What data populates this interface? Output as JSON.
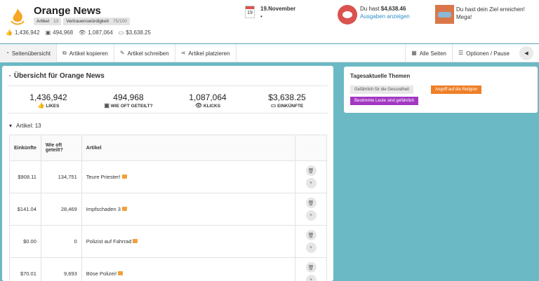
{
  "header": {
    "brand": "Orange News",
    "badges": {
      "article_label": "Artikel",
      "article_count": "13",
      "trust_label": "Vertrauenswürdigkeit",
      "trust_value": "75/100"
    },
    "stats": {
      "likes": "1,436,942",
      "shares": "494,968",
      "clicks": "1,087,064",
      "income": "$3,638.25"
    },
    "date": "19.November",
    "calendar_day": "19",
    "dot": "•",
    "money_prefix": "Du hast ",
    "money_value": "$4,638.46",
    "money_link": "Ausgaben anzeigen",
    "goal_text": "Du hast dein Ziel erreichen! Mega!"
  },
  "nav": {
    "overview": "Seitenübersicht",
    "copy": "Artikel kopieren",
    "write": "Artikel schreiben",
    "place": "Artikel platzieren",
    "all_pages": "Alle Seiten",
    "options": "Optionen / Pause"
  },
  "main": {
    "title": "Übersicht für Orange News",
    "kpis": {
      "likes_value": "1,436,942",
      "likes_label": "LIKES",
      "shares_value": "494,968",
      "shares_label": "WIE OFT GETEILT?",
      "clicks_value": "1,087,064",
      "clicks_label": "KLICKS",
      "income_value": "$3,638.25",
      "income_label": "EINKÜNFTE"
    },
    "articles_label": "Artikel: 13",
    "table": {
      "headers": {
        "income": "Einkünfte",
        "shares": "Wie oft geteilt?",
        "article": "Artikel"
      },
      "rows": [
        {
          "income": "$908.11",
          "shares": "134,751",
          "title": "Teure Priester!"
        },
        {
          "income": "$141.04",
          "shares": "28,469",
          "title": "Impfschaden 3"
        },
        {
          "income": "$0.00",
          "shares": "0",
          "title": "Polizist auf Fahrrad"
        },
        {
          "income": "$70.01",
          "shares": "9,693",
          "title": "Böse Polizei!"
        }
      ]
    }
  },
  "side": {
    "title": "Tagesaktuelle Themen",
    "tags": [
      "Gefährlich für die Gesundheit",
      "Angriff auf die Religion",
      "Bestimmte Leute sind gefährlich"
    ]
  },
  "colors": {
    "accent": "#6bb9c4",
    "orange_tag": "#ef7f27",
    "purple_tag": "#a238c2",
    "pig": "#d9534f"
  }
}
